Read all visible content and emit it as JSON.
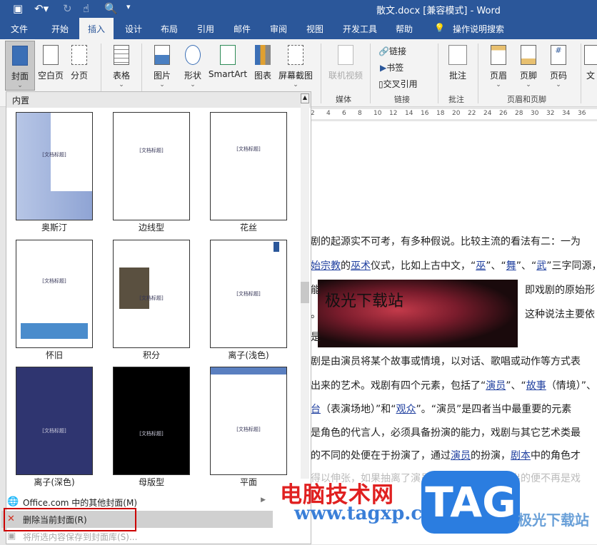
{
  "window": {
    "title": "散文.docx [兼容模式]  -  Word"
  },
  "qat": {
    "save": "save-icon",
    "undo": "undo-icon",
    "redo": "redo-icon",
    "touch": "touch-mode-icon",
    "preview": "print-preview-icon",
    "more": "▾"
  },
  "tabs": [
    "文件",
    "开始",
    "插入",
    "设计",
    "布局",
    "引用",
    "邮件",
    "审阅",
    "视图",
    "开发工具",
    "帮助"
  ],
  "tell_me": "操作说明搜索",
  "ribbon": {
    "cover": "封面",
    "blank": "空白页",
    "break": "分页",
    "table": "表格",
    "picture": "图片",
    "shapes": "形状",
    "smartart": "SmartArt",
    "chart": "图表",
    "screenshot": "屏幕截图",
    "video": "联机视频",
    "link": "链接",
    "bookmark": "书签",
    "crossref": "交叉引用",
    "comment": "批注",
    "header": "页眉",
    "footer": "页脚",
    "pagenum": "页码",
    "text": "文",
    "groups": {
      "media": "媒体",
      "links": "链接",
      "comments": "批注",
      "hf": "页眉和页脚"
    }
  },
  "ruler": [
    "2",
    "4",
    "6",
    "8",
    "10",
    "12",
    "14",
    "16",
    "18",
    "20",
    "22",
    "24",
    "26",
    "28",
    "30",
    "32",
    "34",
    "36"
  ],
  "gallery": {
    "header": "内置",
    "items": [
      {
        "name": "奥斯汀",
        "title": "[文档标题]"
      },
      {
        "name": "边线型",
        "title": "[文档标题]"
      },
      {
        "name": "花丝",
        "title": "[文档标题]"
      },
      {
        "name": "怀旧",
        "title": "[文档标题]"
      },
      {
        "name": "积分",
        "title": "[文档标题]"
      },
      {
        "name": "离子(浅色)",
        "title": "[文档标题]"
      },
      {
        "name": "离子(深色)",
        "title": "[文档标题]"
      },
      {
        "name": "母版型",
        "title": "[文档标题]"
      },
      {
        "name": "平面",
        "title": "[文档标题]"
      }
    ],
    "menu": [
      "Office.com 中的其他封面(M)",
      "删除当前封面(R)",
      "将所选内容保存到封面库(S)..."
    ]
  },
  "document": {
    "lines": [
      [
        "剧的起源实不可考，有多种假说。比较主流的看法有二：一为"
      ],
      [
        "始宗教",
        "的",
        "巫术",
        "仪式，比如上古中文，“",
        "巫",
        "”、“",
        "舞",
        "”、“",
        "武",
        "”三字同源，"
      ],
      [
        "能",
        "即戏剧的原始形"
      ],
      [
        "。",
        "这种说法主要依"
      ],
      [
        "是"
      ],
      [
        "剧是由演员将某个故事或情境，以对话、歌唱或动作等方式表"
      ],
      [
        "出来的艺术。戏剧有四个元素，包括了“",
        "演员",
        "”、“",
        "故事",
        "（情境）”、"
      ],
      [
        "台",
        "（表演场地）”和“",
        "观众",
        "”。“演员”是四者当中最重要的元素"
      ],
      [
        "是角色的代言人，必须具备扮演的能力，戏剧与其它艺术类最"
      ],
      [
        "的不同的处便在于扮演了，通过",
        "演员",
        "的扮演，",
        "剧本",
        "中的角色才"
      ],
      [
        "得以伸张，如果抽离了演员的扮演，那么所演出的便不再是戏"
      ]
    ],
    "image_caption": "极光下载站"
  },
  "watermarks": {
    "site_cn": "电脑技术网",
    "site_url": "www.tagxp.com",
    "tag": "TAG",
    "xz7": "极光下载站"
  }
}
